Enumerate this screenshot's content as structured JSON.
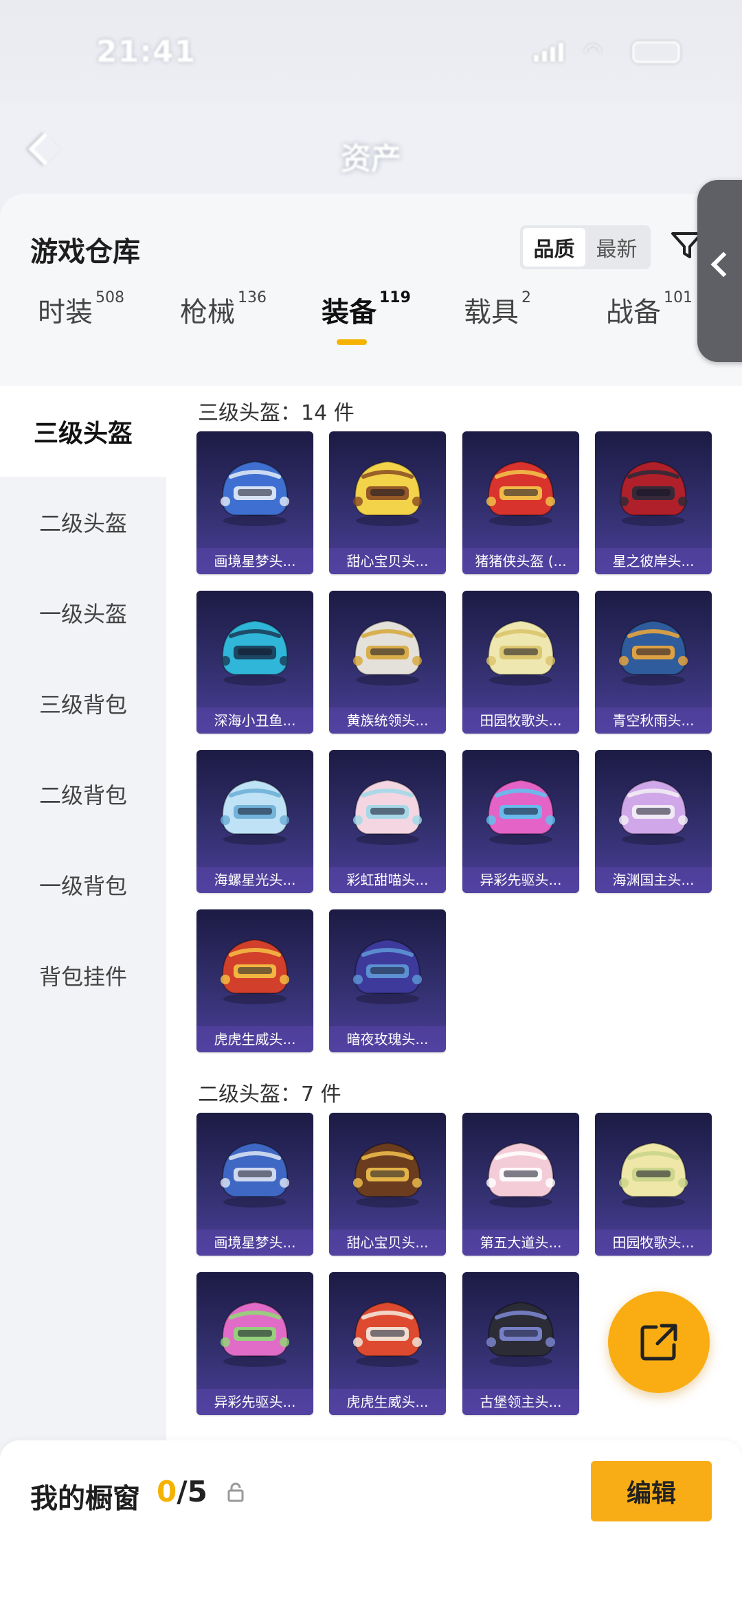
{
  "status_bar": {
    "time": "21:41"
  },
  "nav": {
    "title": "资产"
  },
  "sheet": {
    "title": "游戏仓库",
    "sort_options": [
      "品质",
      "最新"
    ],
    "sort_active": "品质"
  },
  "tabs": [
    {
      "label": "时装",
      "count": "508"
    },
    {
      "label": "枪械",
      "count": "136"
    },
    {
      "label": "装备",
      "count": "119",
      "active": true
    },
    {
      "label": "载具",
      "count": "2"
    },
    {
      "label": "战备",
      "count": "101"
    }
  ],
  "sidebar": {
    "items": [
      {
        "label": "三级头盔",
        "active": true
      },
      {
        "label": "二级头盔"
      },
      {
        "label": "一级头盔"
      },
      {
        "label": "三级背包"
      },
      {
        "label": "二级背包"
      },
      {
        "label": "一级背包"
      },
      {
        "label": "背包挂件"
      }
    ]
  },
  "sections": [
    {
      "header": "三级头盔：14 件",
      "items": [
        {
          "name": "画境星梦头...",
          "color": "#3f6fd0",
          "accent": "#e6eef8"
        },
        {
          "name": "甜心宝贝头...",
          "color": "#f2d34a",
          "accent": "#8a4b22"
        },
        {
          "name": "猪猪侠头盔 (...",
          "color": "#d8332c",
          "accent": "#f3c84b"
        },
        {
          "name": "星之彼岸头...",
          "color": "#b0202a",
          "accent": "#2a2a3a"
        },
        {
          "name": "深海小丑鱼...",
          "color": "#2fb6d8",
          "accent": "#1b3a55"
        },
        {
          "name": "黄族统领头...",
          "color": "#e4e0da",
          "accent": "#d6a73a"
        },
        {
          "name": "田园牧歌头...",
          "color": "#efe7b0",
          "accent": "#d9c36a"
        },
        {
          "name": "青空秋雨头...",
          "color": "#2f5c9c",
          "accent": "#f1a83a"
        },
        {
          "name": "海螺星光头...",
          "color": "#bfe2f6",
          "accent": "#6aaed6"
        },
        {
          "name": "彩虹甜喵头...",
          "color": "#f3d6e2",
          "accent": "#9fd8e8"
        },
        {
          "name": "异彩先驱头...",
          "color": "#e463c6",
          "accent": "#5ac4f0"
        },
        {
          "name": "海渊国主头...",
          "color": "#d0a7e8",
          "accent": "#f4f1f6"
        },
        {
          "name": "虎虎生威头...",
          "color": "#d2402c",
          "accent": "#f6c244"
        },
        {
          "name": "暗夜玫瑰头...",
          "color": "#3d3a9c",
          "accent": "#5f9ad8"
        }
      ]
    },
    {
      "header": "二级头盔：7 件",
      "items": [
        {
          "name": "画境星梦头...",
          "color": "#3f68c4",
          "accent": "#dfe7f5"
        },
        {
          "name": "甜心宝贝头...",
          "color": "#6b3d1e",
          "accent": "#f2c14d"
        },
        {
          "name": "第五大道头...",
          "color": "#f3ccd8",
          "accent": "#ffffff"
        },
        {
          "name": "田园牧歌头...",
          "color": "#eee7a8",
          "accent": "#c8d48a"
        },
        {
          "name": "异彩先驱头...",
          "color": "#e06cc8",
          "accent": "#8edb73"
        },
        {
          "name": "虎虎生威头...",
          "color": "#dd4a30",
          "accent": "#f4ede2"
        },
        {
          "name": "古堡领主头...",
          "color": "#2c2c36",
          "accent": "#7f8ad6"
        }
      ]
    }
  ],
  "showcase": {
    "title": "我的橱窗",
    "current": "0",
    "total": "/5",
    "edit_label": "编辑"
  },
  "colors": {
    "accent": "#f5b200",
    "card_bg": "#2d2a66"
  }
}
